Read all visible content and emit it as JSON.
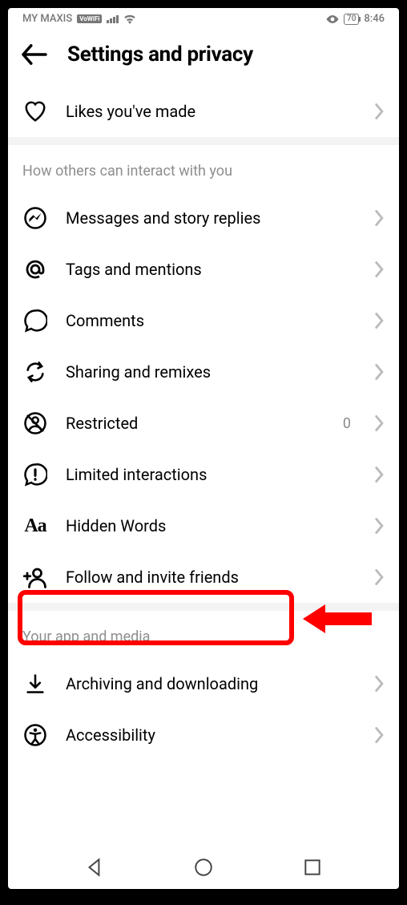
{
  "status_bar": {
    "carrier": "MY MAXIS",
    "vowifi_badge": "VoWiFi",
    "battery": "70",
    "time": "8:46"
  },
  "header": {
    "title": "Settings and privacy"
  },
  "top_row": {
    "label": "Likes you've made"
  },
  "section_interact": {
    "header": "How others can interact with you",
    "items": [
      {
        "label": "Messages and story replies",
        "icon": "messenger"
      },
      {
        "label": "Tags and mentions",
        "icon": "at"
      },
      {
        "label": "Comments",
        "icon": "comment"
      },
      {
        "label": "Sharing and remixes",
        "icon": "remix"
      },
      {
        "label": "Restricted",
        "icon": "restricted",
        "badge": "0"
      },
      {
        "label": "Limited interactions",
        "icon": "limited"
      },
      {
        "label": "Hidden Words",
        "icon": "aa"
      },
      {
        "label": "Follow and invite friends",
        "icon": "invite"
      }
    ]
  },
  "section_app": {
    "header": "Your app and media",
    "items": [
      {
        "label": "Archiving and downloading",
        "icon": "download"
      },
      {
        "label": "Accessibility",
        "icon": "accessibility"
      }
    ]
  },
  "highlight": {
    "color": "#ff0000"
  }
}
